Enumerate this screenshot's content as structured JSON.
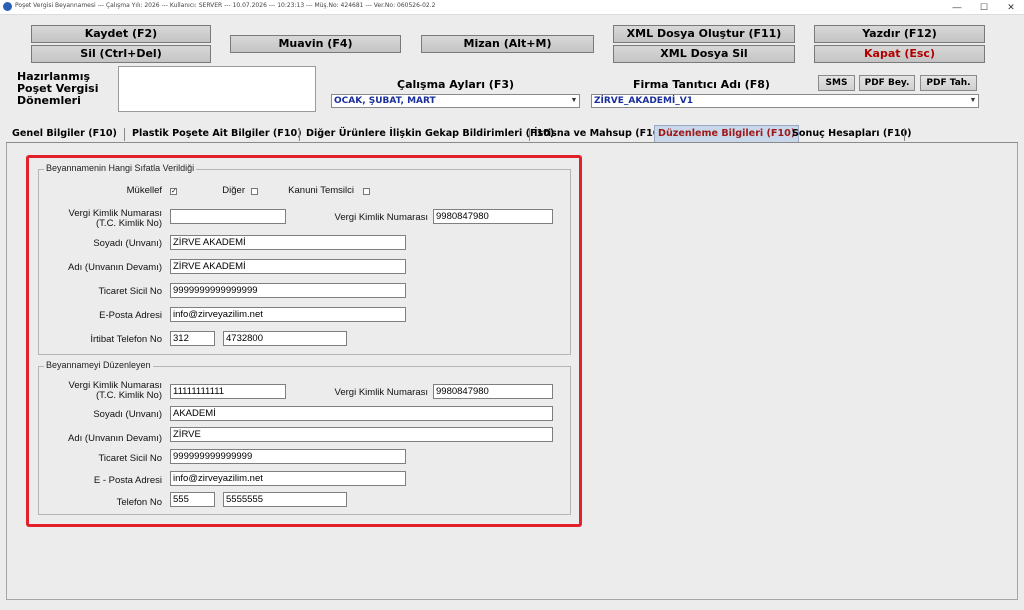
{
  "window": {
    "title": "Poşet Vergisi Beyannamesi  ---  Çalışma Yılı: 2026  ---  Kullanıcı: SERVER  ---  10.07.2026  ---  10:23:13  ---  Müş.No: 424681  ---  Ver.No: 060526-02.2",
    "minimize": "—",
    "maximize": "☐",
    "close": "✕"
  },
  "toolbar": {
    "save": "Kaydet (F2)",
    "delete": "Sil (Ctrl+Del)",
    "muavin": "Muavin (F4)",
    "mizan": "Mizan (Alt+M)",
    "xml_create": "XML Dosya Oluştur (F11)",
    "xml_delete": "XML Dosya Sil",
    "print": "Yazdır (F12)",
    "close": "Kapat (Esc)",
    "sms": "SMS",
    "pdf_bey": "PDF Bey.",
    "pdf_tah": "PDF Tah."
  },
  "header": {
    "prepared_label_1": "Hazırlanmış",
    "prepared_label_2": "Poşet Vergisi",
    "prepared_label_3": "Dönemleri",
    "months_label": "Çalışma Ayları (F3)",
    "months_value": "OCAK, ŞUBAT, MART",
    "company_label": "Firma Tanıtıcı Adı (F8)",
    "company_value": "ZİRVE_AKADEMİ_V1"
  },
  "tabs": [
    {
      "label": "Genel Bilgiler (F10)"
    },
    {
      "label": "Plastik Poşete Ait Bilgiler (F10)"
    },
    {
      "label": "Diğer Ürünlere İlişkin Gekap Bildirimleri (F10)"
    },
    {
      "label": "İstisna ve Mahsup (F10)"
    },
    {
      "label": "Düzenleme Bilgileri (F10)"
    },
    {
      "label": "Sonuç Hesapları (F10)"
    }
  ],
  "section1": {
    "title": "Beyannamenin Hangi Sıfatla Verildiği",
    "chk_mukellef": "Mükellef",
    "chk_mukellef_mark": "✓",
    "chk_diger": "Diğer",
    "chk_kanuni": "Kanuni Temsilci",
    "tc_label_1": "Vergi Kimlik Numarası",
    "tc_label_2": "(T.C. Kimlik No)",
    "tc_value": "",
    "vkn_label": "Vergi Kimlik Numarası",
    "vkn_value": "9980847980",
    "soyadi_label": "Soyadı (Unvanı)",
    "soyadi_value": "ZİRVE AKADEMİ",
    "adi_label": "Adı (Unvanın Devamı)",
    "adi_value": "ZİRVE AKADEMİ",
    "ticaret_label": "Ticaret Sicil No",
    "ticaret_value": "9999999999999999",
    "eposta_label": "E-Posta Adresi",
    "eposta_value": "info@zirveyazilim.net",
    "telefon_label": "İrtibat Telefon No",
    "telefon_kod": "312",
    "telefon_no": "4732800"
  },
  "section2": {
    "title": "Beyannameyi Düzenleyen",
    "tc_label_1": "Vergi Kimlik Numarası",
    "tc_label_2": "(T.C. Kimlik No)",
    "tc_value": "11111111111",
    "vkn_label": "Vergi Kimlik Numarası",
    "vkn_value": "9980847980",
    "soyadi_label": "Soyadı (Unvanı)",
    "soyadi_value": "AKADEMİ",
    "adi_label": "Adı (Unvanın Devamı)",
    "adi_value": "ZİRVE",
    "ticaret_label": "Ticaret Sicil No",
    "ticaret_value": "999999999999999",
    "eposta_label": "E - Posta Adresi",
    "eposta_value": "info@zirveyazilim.net",
    "telefon_label": "Telefon No",
    "telefon_kod": "555",
    "telefon_no": "5555555"
  },
  "colors": {
    "highlight": "#e3202a",
    "active_tab_bg": "#c9d7ea",
    "active_tab_text": "#a01818",
    "combo_text": "#1a2f9a",
    "close_text": "#b00000"
  }
}
